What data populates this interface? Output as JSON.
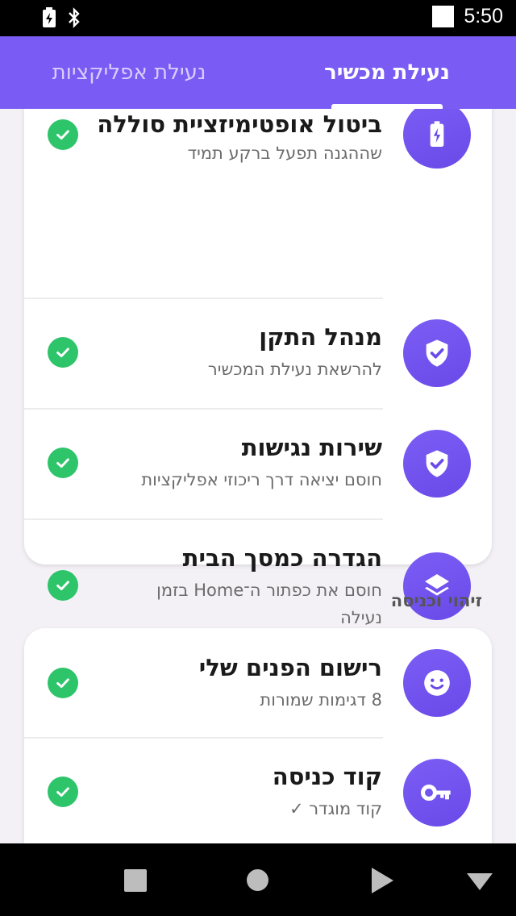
{
  "status_bar": {
    "time": "5:50"
  },
  "tabs": [
    {
      "label": "נעילת מכשיר",
      "active": true
    },
    {
      "label": "נעילת אפליקציות",
      "active": false
    }
  ],
  "permissions_card": {
    "items": [
      {
        "title": "ביטול אופטימיזציית סוללה",
        "subtitle": "שההגנה תפעל ברקע תמיד",
        "icon": "battery-bolt-icon",
        "granted": true
      },
      {
        "title": "מנהל התקן",
        "subtitle": "להרשאת נעילת המכשיר",
        "icon": "shield-check-icon",
        "granted": true
      },
      {
        "title": "שירות נגישות",
        "subtitle": "חוסם יציאה דרך ריכוזי אפליקציות",
        "icon": "shield-check-icon",
        "granted": true
      },
      {
        "title": "הגדרה כמסך הבית",
        "subtitle": "חוסם את כפתור ה־Home בזמן נעילה",
        "icon": "layers-icon",
        "granted": true
      }
    ]
  },
  "auth_section": {
    "label": "זיהוי וכניסה",
    "items": [
      {
        "title": "רישום הפנים שלי",
        "subtitle": "8 דגימות שמורות",
        "icon": "face-icon",
        "granted": true
      },
      {
        "title": "קוד כניסה",
        "subtitle": "קוד מוגדר ✓",
        "icon": "key-icon",
        "granted": true
      }
    ]
  },
  "colors": {
    "accent": "#7a5cf4",
    "success": "#2ec46a"
  }
}
